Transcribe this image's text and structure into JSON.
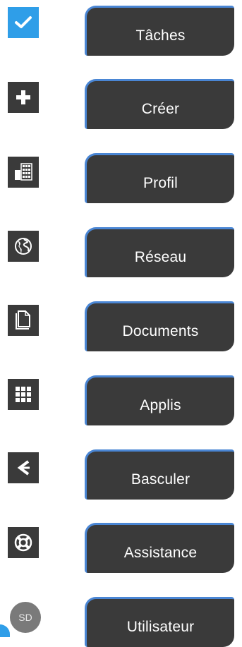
{
  "menu": {
    "items": [
      {
        "key": "tasks",
        "label": "Tâches",
        "icon": "check-icon",
        "active": true
      },
      {
        "key": "create",
        "label": "Créer",
        "icon": "plus-icon",
        "active": false
      },
      {
        "key": "profile",
        "label": "Profil",
        "icon": "profile-grid-icon",
        "active": false
      },
      {
        "key": "network",
        "label": "Réseau",
        "icon": "globe-icon",
        "active": false
      },
      {
        "key": "documents",
        "label": "Documents",
        "icon": "document-icon",
        "active": false
      },
      {
        "key": "apps",
        "label": "Applis",
        "icon": "apps-grid-icon",
        "active": false
      },
      {
        "key": "switch",
        "label": "Basculer",
        "icon": "switch-arrow-icon",
        "active": false
      },
      {
        "key": "support",
        "label": "Assistance",
        "icon": "lifebuoy-icon",
        "active": false
      },
      {
        "key": "user",
        "label": "Utilisateur",
        "icon": "avatar",
        "active": false
      }
    ],
    "user_initials": "SD"
  },
  "colors": {
    "icon_background": "#3a3a3a",
    "active_icon_background": "#2f9ee8",
    "button_background": "#3a3a3a",
    "button_border": "#4a86d4",
    "avatar_background": "#7a7a7a",
    "text": "#ffffff"
  }
}
